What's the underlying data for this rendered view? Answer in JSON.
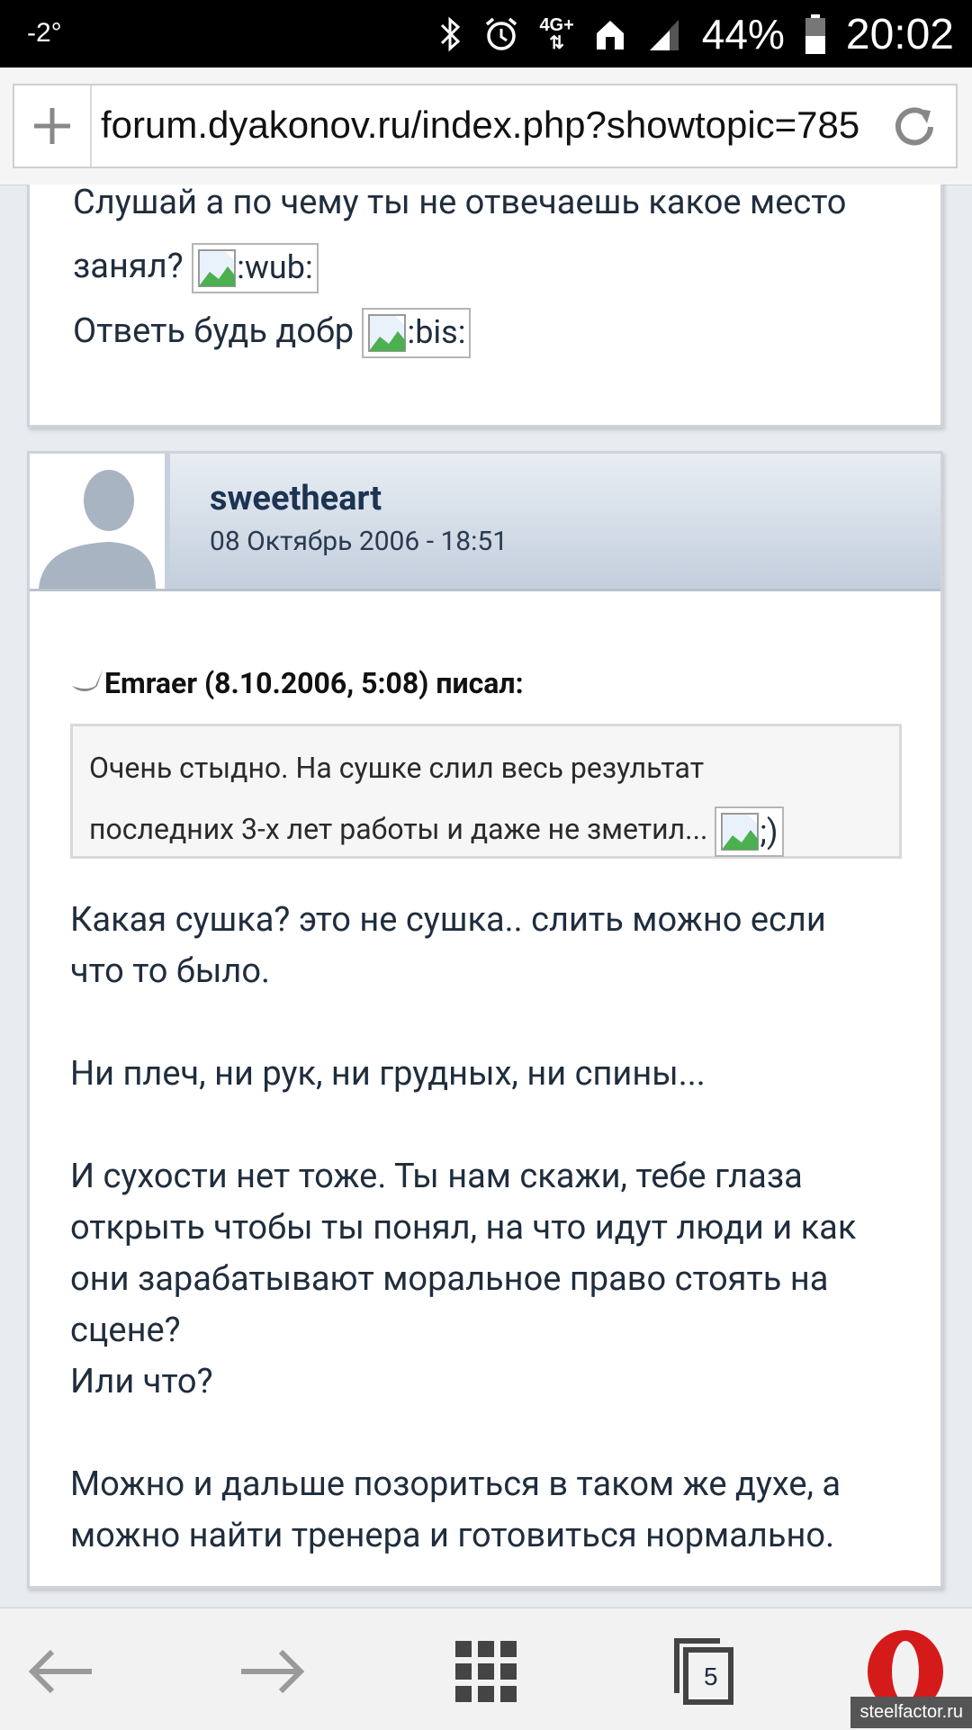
{
  "status_bar": {
    "temperature": "-2°",
    "network": "4G+",
    "battery": "44%",
    "time": "20:02",
    "icons": [
      "bluetooth-icon",
      "alarm-icon",
      "network-arrows-icon",
      "home-icon",
      "signal-icon",
      "battery-icon"
    ]
  },
  "address_bar": {
    "url": "forum.dyakonov.ru/index.php?showtopic=785"
  },
  "post1": {
    "line1": "Слушай а по чему ты не отвечаешь какое место",
    "line2": "занял?",
    "emoticon1": ":wub:",
    "line3": "Ответь будь добр",
    "emoticon2": ":bis:"
  },
  "post2": {
    "username": "sweetheart",
    "date": "08 Октябрь 2006 - 18:51",
    "quote_author": "Emraer (8.10.2006, 5:08) писал:",
    "quote_line1": "Очень стыдно. На сушке слил весь результат",
    "quote_line2": "последних 3-х лет работы и даже не зметил...",
    "quote_emoticon": ";)",
    "para1_line1": "Какая сушка? это не сушка.. слить можно если",
    "para1_line2": "что то было.",
    "para2": "Ни плеч, ни рук, ни грудных, ни спины...",
    "para3_line1": "И сухости нет тоже. Ты нам скажи, тебе глаза",
    "para3_line2": "открыть чтобы ты понял, на что идут люди и как",
    "para3_line3": "они зарабатывают моральное право стоять на",
    "para3_line4": "сцене?",
    "para3_line5": "Или что?",
    "para4_line1": "Можно и дальше позориться в таком же духе, а",
    "para4_line2": "можно найти тренера и готовиться нормально."
  },
  "toolbar": {
    "tab_count": "5"
  },
  "watermark": "steelfactor.ru"
}
